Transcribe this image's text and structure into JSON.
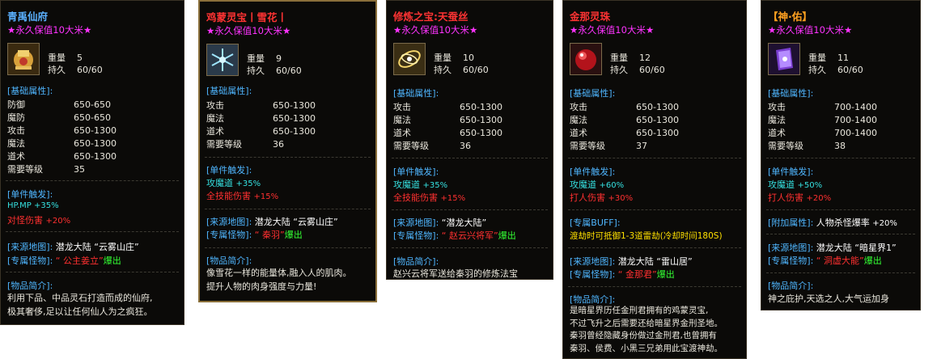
{
  "colors": {
    "title_blue": "#5ab0ff",
    "title_red": "#ff3333",
    "title_orange": "#ffa020",
    "tag": "#ff33ff",
    "section": "#4fb6ff",
    "cyan": "#35e0e0",
    "red": "#ff3030",
    "green": "#33ff33",
    "yellow": "#ffe000"
  },
  "cards": [
    {
      "title": "青禹仙府",
      "tag": "★永久保值10大米★",
      "icon": "golden-helmet-icon",
      "weight_label": "重量",
      "weight": "5",
      "durability_label": "持久",
      "durability": "60/60",
      "base_header": "[基础属性]:",
      "stats": [
        {
          "k": "防御",
          "v": "650-650"
        },
        {
          "k": "魔防",
          "v": "650-650"
        },
        {
          "k": "攻击",
          "v": "650-1300"
        },
        {
          "k": "魔法",
          "v": "650-1300"
        },
        {
          "k": "道术",
          "v": "650-1300"
        },
        {
          "k": "需要等级",
          "v": "35"
        }
      ],
      "trigger_header": "[单件触发]:",
      "trigger_line1": "HP.MP +35%",
      "trigger2_label": "对怪伤害",
      "trigger2_value": "+20%",
      "map_label": "[来源地图]:",
      "map_value": "潜龙大陆 “云雾山庄”",
      "monster_label": "[专属怪物]:",
      "monster_name": "“ 公主姜立”",
      "monster_suffix": "爆出",
      "intro_header": "[物品简介]:",
      "intro_lines": [
        "利用下品、中品灵石打造而成的仙府,",
        "极其奢侈,足以让任何仙人为之疯狂。"
      ]
    },
    {
      "title": "鸡蒙灵宝丨雪花丨",
      "tag": "★永久保值10大米★",
      "icon": "snowflake-icon",
      "weight_label": "重量",
      "weight": "9",
      "durability_label": "持久",
      "durability": "60/60",
      "base_header": "[基础属性]:",
      "stats": [
        {
          "k": "攻击",
          "v": "650-1300"
        },
        {
          "k": "魔法",
          "v": "650-1300"
        },
        {
          "k": "道术",
          "v": "650-1300"
        },
        {
          "k": "需要等级",
          "v": "36"
        }
      ],
      "trigger_header": "[单件触发]:",
      "trigger1_label": "攻魔道",
      "trigger1_value": "+35%",
      "trigger2_label": "全技能伤害",
      "trigger2_value": "+15%",
      "map_label": "[来源地图]:",
      "map_value": "潜龙大陆 “云雾山庄”",
      "monster_label": "[专属怪物]:",
      "monster_name": "“ 秦羽”",
      "monster_suffix": "爆出",
      "intro_header": "[物品简介]:",
      "intro_lines": [
        "像雪花一样的能量体,融入人的肌肉。",
        "提升人物的肉身强度与力量!"
      ]
    },
    {
      "title": "修炼之宝:天蚕丝",
      "tag": "★永久保值10大米★",
      "icon": "silk-thread-icon",
      "weight_label": "重量",
      "weight": "10",
      "durability_label": "持久",
      "durability": "60/60",
      "base_header": "[基础属性]:",
      "stats": [
        {
          "k": "攻击",
          "v": "650-1300"
        },
        {
          "k": "魔法",
          "v": "650-1300"
        },
        {
          "k": "道术",
          "v": "650-1300"
        },
        {
          "k": "需要等级",
          "v": "36"
        }
      ],
      "trigger_header": "[单件触发]:",
      "trigger1_label": "攻魔道",
      "trigger1_value": "+35%",
      "trigger2_label": "全技能伤害",
      "trigger2_value": "+15%",
      "map_label": "[来源地图]:",
      "map_value": "“潜龙大陆”",
      "monster_label": "[专属怪物]:",
      "monster_name": "“ 赵云兴将军”",
      "monster_suffix": "爆出",
      "intro_header": "[物品简介]:",
      "intro_lines": [
        "赵兴云将军送给秦羽的修炼法宝"
      ]
    },
    {
      "title": "金那灵珠",
      "tag": "★永久保值10大米★",
      "icon": "red-pearl-icon",
      "weight_label": "重量",
      "weight": "12",
      "durability_label": "持久",
      "durability": "60/60",
      "base_header": "[基础属性]:",
      "stats": [
        {
          "k": "攻击",
          "v": "650-1300"
        },
        {
          "k": "魔法",
          "v": "650-1300"
        },
        {
          "k": "道术",
          "v": "650-1300"
        },
        {
          "k": "需要等级",
          "v": "37"
        }
      ],
      "trigger_header": "[单件触发]:",
      "trigger1_label": "攻魔道",
      "trigger1_value": "+60%",
      "trigger2_label": "打人伤害",
      "trigger2_value": "+30%",
      "buff_header": "[专属BUFF]:",
      "buff_text": "渡劫时可抵御1-3道雷劫(冷却时间180S)",
      "map_label": "[来源地图]:",
      "map_value": "潜龙大陆 “雷山居”",
      "monster_label": "[专属怪物]:",
      "monster_name": "“ 金那君”",
      "monster_suffix": "爆出",
      "intro_header": "[物品简介]:",
      "intro_lines": [
        "是暗星界历任金刑君拥有的鸡蒙灵宝,",
        "不过飞升之后需要还给暗星界金刑圣地。",
        "秦羽曾经隐藏身份做过金刑君,也曾拥有",
        "秦羽、侯费、小黑三兄弟用此宝渡神劫。"
      ]
    },
    {
      "title": "【神·佑】",
      "tag": "★永久保值10大米★",
      "icon": "purple-book-icon",
      "weight_label": "重量",
      "weight": "11",
      "durability_label": "持久",
      "durability": "60/60",
      "base_header": "[基础属性]:",
      "stats": [
        {
          "k": "攻击",
          "v": "700-1400"
        },
        {
          "k": "魔法",
          "v": "700-1400"
        },
        {
          "k": "道术",
          "v": "700-1400"
        },
        {
          "k": "需要等级",
          "v": "38"
        }
      ],
      "trigger_header": "[单件触发]:",
      "trigger1_label": "攻魔道",
      "trigger1_value": "+50%",
      "trigger2_label": "打人伤害",
      "trigger2_value": "+20%",
      "extra_header": "[附加属性]:",
      "extra_label": "人物杀怪爆率",
      "extra_value": "+20%",
      "map_label": "[来源地图]:",
      "map_value": "潜龙大陆 “暗星界1”",
      "monster_label": "[专属怪物]:",
      "monster_name": "“ 洞虚大能”",
      "monster_suffix": "爆出",
      "intro_header": "[物品简介]:",
      "intro_lines": [
        "神之庇护,天选之人,大气运加身"
      ]
    }
  ]
}
